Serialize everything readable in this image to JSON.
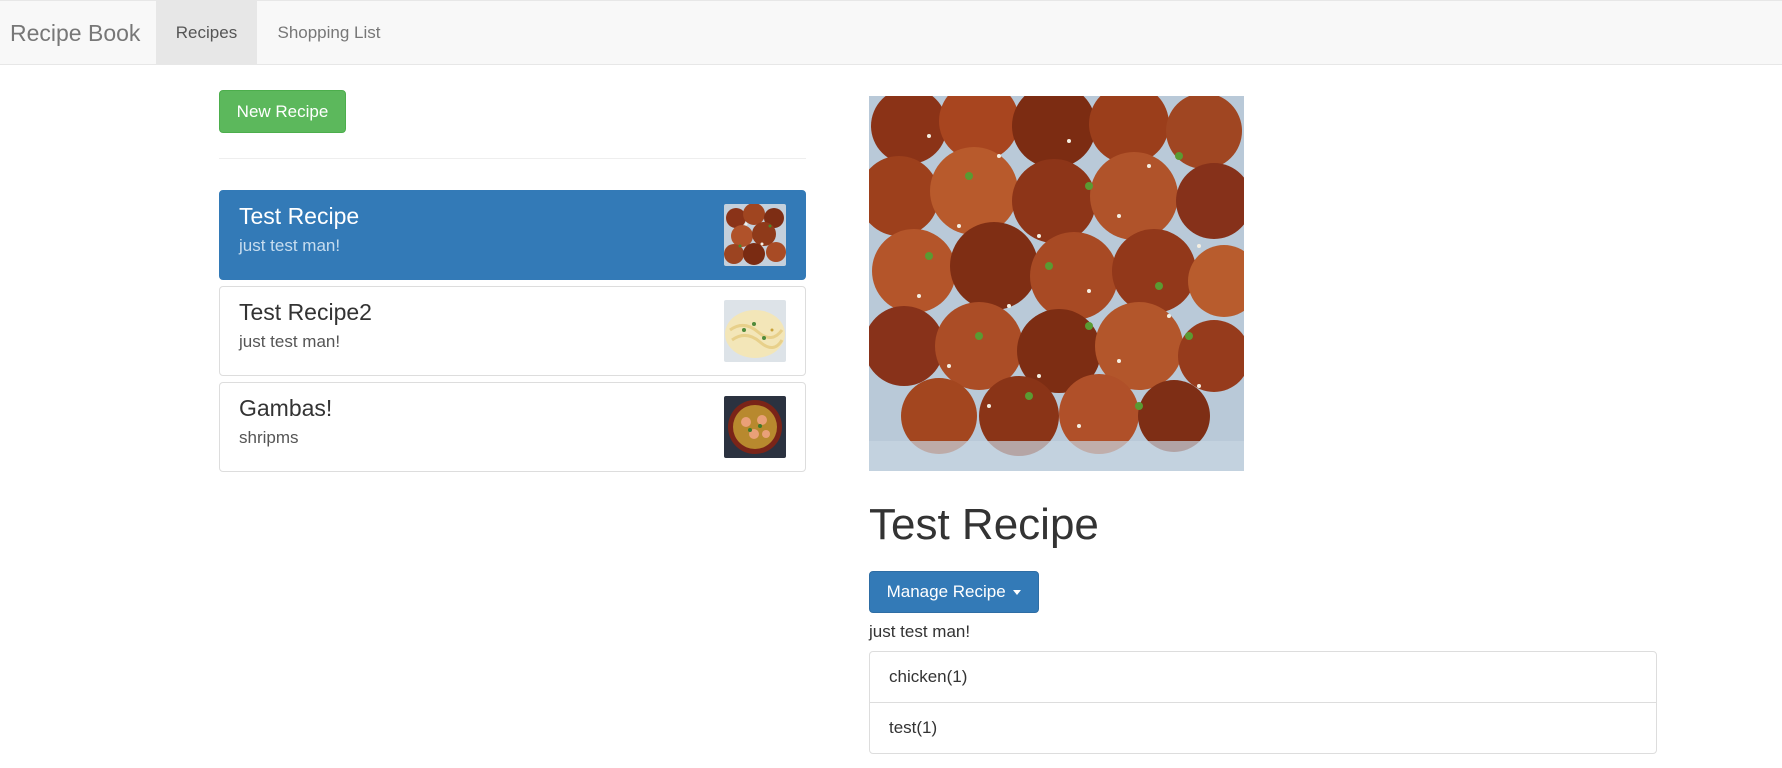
{
  "navbar": {
    "brand": "Recipe Book",
    "links": [
      {
        "label": "Recipes",
        "active": true
      },
      {
        "label": "Shopping List",
        "active": false
      }
    ]
  },
  "sidebar": {
    "new_button": "New Recipe",
    "recipes": [
      {
        "name": "Test Recipe",
        "description": "just test man!",
        "active": true,
        "image": "fried-chicken-photo"
      },
      {
        "name": "Test Recipe2",
        "description": "just test man!",
        "active": false,
        "image": "pasta-photo"
      },
      {
        "name": "Gambas!",
        "description": "shripms",
        "active": false,
        "image": "shrimp-dish-photo"
      }
    ]
  },
  "detail": {
    "image": "fried-chicken-photo",
    "title": "Test Recipe",
    "manage_button": "Manage Recipe",
    "description": "just test man!",
    "ingredients": [
      {
        "label": "chicken(1)"
      },
      {
        "label": "test(1)"
      }
    ]
  },
  "colors": {
    "primary": "#337ab7",
    "success": "#5cb85c",
    "navbar_bg": "#f8f8f8"
  }
}
